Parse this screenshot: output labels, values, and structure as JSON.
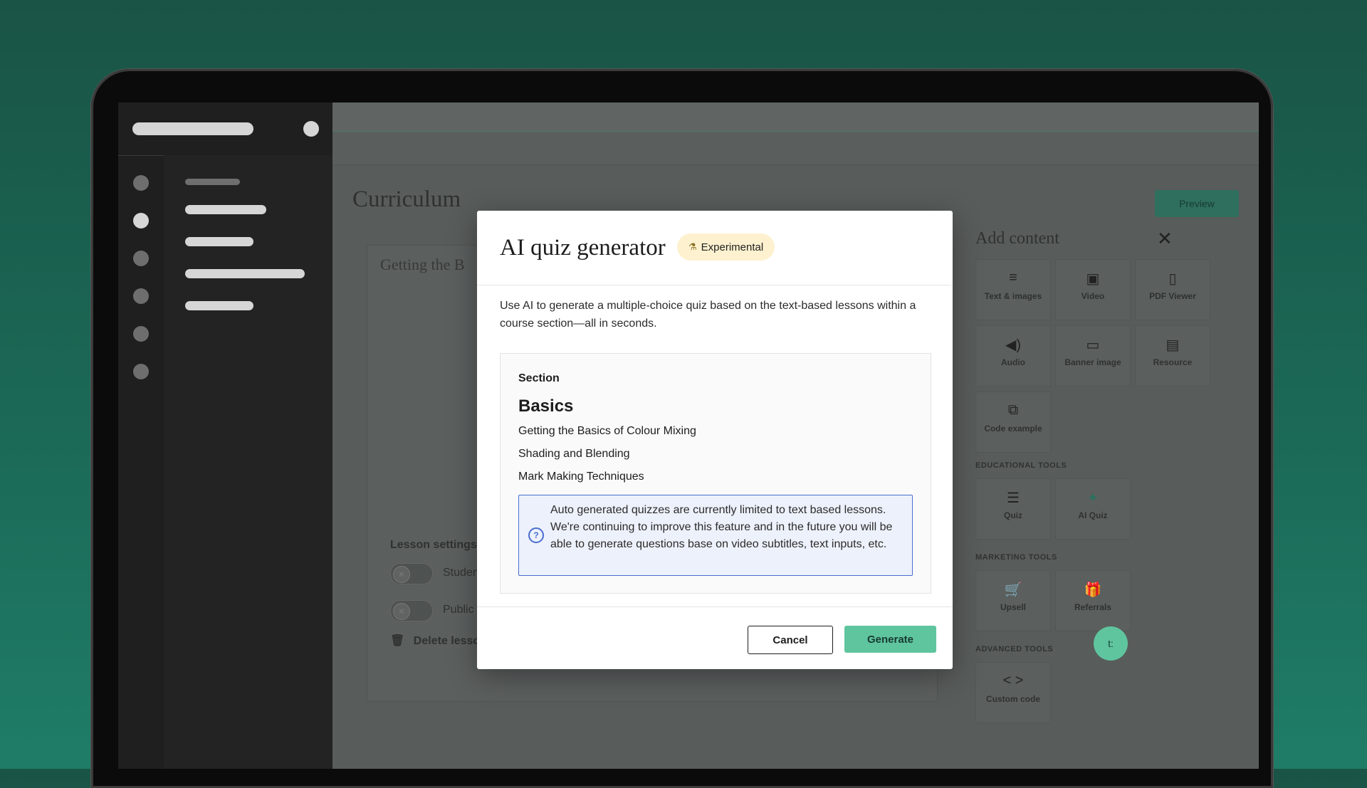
{
  "main": {
    "page_title": "Curriculum",
    "preview_label": "Preview",
    "lesson_title": "Getting the B",
    "lesson_settings_label": "Lesson settings",
    "toggle1_label": "Studen",
    "toggle2_label": "Public",
    "delete_label": "Delete lesso"
  },
  "add_content": {
    "title": "Add content",
    "tiles": [
      {
        "label": "Text & images",
        "icon": "text-icon"
      },
      {
        "label": "Video",
        "icon": "video-icon"
      },
      {
        "label": "PDF Viewer",
        "icon": "pdf-icon"
      },
      {
        "label": "Audio",
        "icon": "audio-icon"
      },
      {
        "label": "Banner image",
        "icon": "image-icon"
      },
      {
        "label": "Resource",
        "icon": "resource-icon"
      },
      {
        "label": "Code example",
        "icon": "code-icon"
      }
    ],
    "educational_tools_label": "EDUCATIONAL TOOLS",
    "edu_tiles": [
      {
        "label": "Quiz",
        "icon": "quiz-icon"
      },
      {
        "label": "AI Quiz",
        "icon": "sparkle-icon"
      }
    ],
    "marketing_tools_label": "MARKETING TOOLS",
    "mkt_tiles": [
      {
        "label": "Upsell",
        "icon": "cart-icon"
      },
      {
        "label": "Referrals",
        "icon": "gift-icon"
      }
    ],
    "advanced_tools_label": "ADVANCED TOOLS",
    "adv_tiles": [
      {
        "label": "Custom code",
        "icon": "code-brackets-icon"
      }
    ]
  },
  "modal": {
    "title": "AI quiz generator",
    "badge": "Experimental",
    "description": "Use AI to generate a multiple-choice quiz based on the text-based lessons within a course section—all in seconds.",
    "section_label": "Section",
    "section_name": "Basics",
    "lessons": [
      "Getting the Basics of Colour Mixing",
      "Shading and Blending",
      "Mark Making Techniques"
    ],
    "info_text": "Auto generated quizzes are currently limited to text based lessons. We're continuing to improve this feature and in the future you will be able to generate questions base on video subtitles, text inputs, etc.",
    "cancel_label": "Cancel",
    "generate_label": "Generate"
  },
  "chat_label": "t:",
  "colors": {
    "accent": "#5fc59e",
    "badge_bg": "#fdf1cf",
    "info_border": "#4a6dd0"
  }
}
